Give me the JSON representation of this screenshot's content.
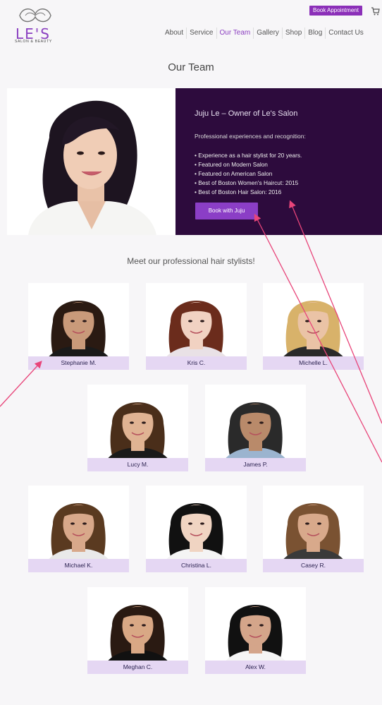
{
  "brand": {
    "name": "LE'S",
    "tagline": "SALON & BEAUTY",
    "accent": "#8b2fb8",
    "hero_bg": "#2d0b3d",
    "name_bar_bg": "#e5d7f3"
  },
  "header": {
    "book_appointment": "Book Appointment",
    "nav": [
      "About",
      "Service",
      "Our Team",
      "Gallery",
      "Shop",
      "Blog",
      "Contact Us"
    ],
    "active_nav": "Our Team"
  },
  "page": {
    "title": "Our Team"
  },
  "hero": {
    "title": "Juju Le – Owner of Le's Salon",
    "subtitle": "Professional experiences and recognition:",
    "items": [
      "• Experience as a hair stylist for 20 years.",
      "• Featured on Modern Salon",
      "• Featured on American Salon",
      "• Best of Boston Women's Haircut: 2015",
      "• Best of Boston Hair Salon: 2016"
    ],
    "button": "Book with Juju"
  },
  "stylists": {
    "heading": "Meet our professional hair stylists!",
    "people": [
      {
        "name": "Stephanie M.",
        "hair": "#2a1a12",
        "skin": "#c99a7a",
        "top": "#1a1a1a"
      },
      {
        "name": "Kris C.",
        "hair": "#6b2c1c",
        "skin": "#f1d2c2",
        "top": "#e9e1e6"
      },
      {
        "name": "Michelle L.",
        "hair": "#d8b26a",
        "skin": "#eac3a6",
        "top": "#2a2a2a"
      },
      {
        "name": "Lucy M.",
        "hair": "#4a2e1a",
        "skin": "#e0b393",
        "top": "#1a1a1a"
      },
      {
        "name": "James P.",
        "hair": "#2a2a2a",
        "skin": "#b98a6a",
        "top": "#9bb4cf"
      },
      {
        "name": "Michael K.",
        "hair": "#5a3a20",
        "skin": "#d8a88a",
        "top": "#e9e9e9"
      },
      {
        "name": "Christina L.",
        "hair": "#111111",
        "skin": "#f0d4c2",
        "top": "#f4f4f4"
      },
      {
        "name": "Casey R.",
        "hair": "#7a5232",
        "skin": "#d8a98b",
        "top": "#3a3a3a"
      },
      {
        "name": "Meghan C.",
        "hair": "#2a1a12",
        "skin": "#d9a885",
        "top": "#111111"
      },
      {
        "name": "Alex W.",
        "hair": "#111111",
        "skin": "#d4a58a",
        "top": "#f5f5f5"
      }
    ]
  }
}
